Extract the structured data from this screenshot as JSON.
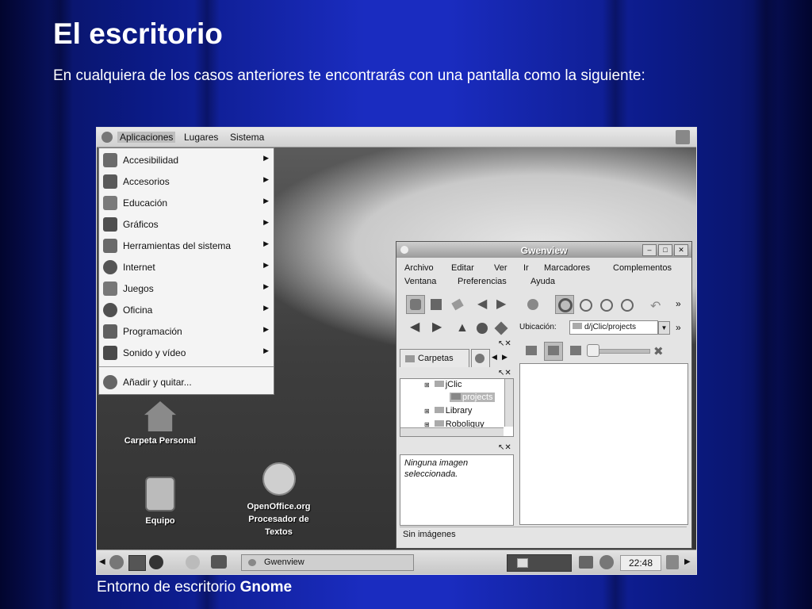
{
  "slide": {
    "title": "El escritorio",
    "subtitle": "En cualquiera de los casos anteriores te encontrarás con una pantalla como la siguiente:",
    "caption_prefix": "Entorno de escritorio ",
    "caption_bold": "Gnome"
  },
  "topbar": {
    "menus": [
      "Aplicaciones",
      "Lugares",
      "Sistema"
    ]
  },
  "apps_menu": {
    "items": [
      {
        "label": "Accesibilidad",
        "icon": "accessibility-icon",
        "color": "#6b6b6b"
      },
      {
        "label": "Accesorios",
        "icon": "accessories-icon",
        "color": "#5a5a5a"
      },
      {
        "label": "Educación",
        "icon": "education-icon",
        "color": "#7a7a7a"
      },
      {
        "label": "Gráficos",
        "icon": "graphics-icon",
        "color": "#4f4f4f"
      },
      {
        "label": "Herramientas del sistema",
        "icon": "system-tools-icon",
        "color": "#6a6a6a"
      },
      {
        "label": "Internet",
        "icon": "internet-icon",
        "color": "#555555"
      },
      {
        "label": "Juegos",
        "icon": "games-icon",
        "color": "#777777"
      },
      {
        "label": "Oficina",
        "icon": "office-icon",
        "color": "#505050"
      },
      {
        "label": "Programación",
        "icon": "programming-icon",
        "color": "#606060"
      },
      {
        "label": "Sonido y vídeo",
        "icon": "sound-video-icon",
        "color": "#4a4a4a"
      }
    ],
    "footer_item": {
      "label": "Añadir y quitar...",
      "icon": "add-remove-icon"
    }
  },
  "desktop_icons": {
    "home": "Carpeta Personal",
    "computer": "Equipo",
    "openoffice": [
      "OpenOffice.org",
      "Procesador de",
      "Textos"
    ]
  },
  "gwenview": {
    "title": "Gwenview",
    "menu_row1": [
      "Archivo",
      "Editar",
      "Ver",
      "Ir",
      "Marcadores",
      "Complementos"
    ],
    "menu_row2": [
      "Ventana",
      "Preferencias",
      "Ayuda"
    ],
    "location_label": "Ubicación:",
    "location_value": "d/jClic/projects",
    "folders_tab": "Carpetas",
    "tree": [
      "jClic",
      "projects",
      "Library",
      "Roboliguy"
    ],
    "info_text": [
      "Ninguna imagen",
      "seleccionada."
    ],
    "status": "Sin imágenes"
  },
  "bottom_panel": {
    "task": "Gwenview",
    "clock": "22:48"
  },
  "colors": {
    "slide_bg": "#1a2cc0",
    "text": "#ffffff"
  }
}
